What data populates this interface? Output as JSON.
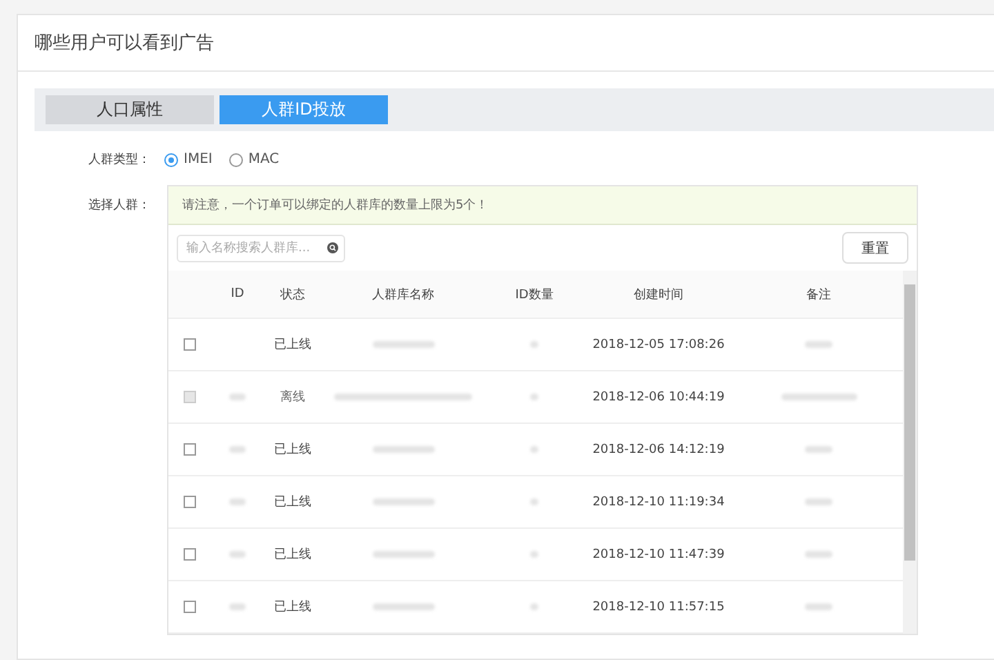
{
  "section_title": "哪些用户可以看到广告",
  "tabs": [
    {
      "label": "人口属性",
      "selected": false
    },
    {
      "label": "人群ID投放",
      "selected": true
    }
  ],
  "crowd_type": {
    "label": "人群类型：",
    "options": [
      {
        "label": "IMEI",
        "selected": true
      },
      {
        "label": "MAC",
        "selected": false
      }
    ]
  },
  "crowd_select": {
    "label": "选择人群：",
    "notice": "请注意，一个订单可以绑定的人群库的数量上限为5个！",
    "search": {
      "placeholder": "输入名称搜索人群库..."
    },
    "reset_button": "重置",
    "table": {
      "columns": [
        "ID",
        "状态",
        "人群库名称",
        "ID数量",
        "创建时间",
        "备注"
      ],
      "rows": [
        {
          "checked": false,
          "disabled": false,
          "status": "已上线",
          "created": "2018-12-05 17:08:26"
        },
        {
          "checked": false,
          "disabled": true,
          "status": "离线",
          "created": "2018-12-06 10:44:19"
        },
        {
          "checked": false,
          "disabled": false,
          "status": "已上线",
          "created": "2018-12-06 14:12:19"
        },
        {
          "checked": false,
          "disabled": false,
          "status": "已上线",
          "created": "2018-12-10 11:19:34"
        },
        {
          "checked": false,
          "disabled": false,
          "status": "已上线",
          "created": "2018-12-10 11:47:39"
        },
        {
          "checked": false,
          "disabled": false,
          "status": "已上线",
          "created": "2018-12-10 11:57:15"
        }
      ]
    }
  }
}
